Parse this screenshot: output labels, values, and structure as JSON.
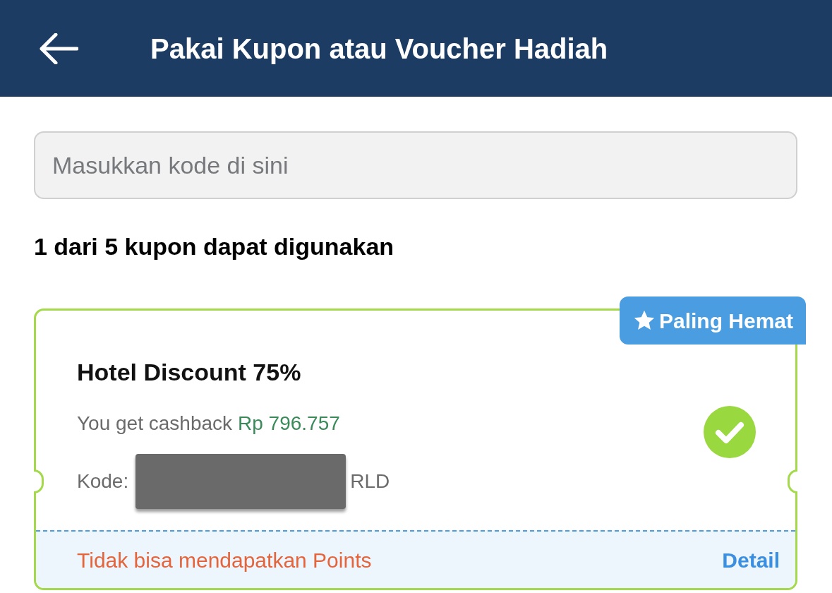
{
  "header": {
    "title": "Pakai Kupon atau Voucher Hadiah"
  },
  "code_field": {
    "placeholder": "Masukkan kode di sini"
  },
  "summary": "1 dari 5 kupon dapat digunakan",
  "coupons": [
    {
      "badge": "Paling Hemat",
      "title": "Hotel Discount 75%",
      "cashback_label": "You get cashback",
      "cashback_amount": "Rp 796.757",
      "code_label": "Kode:",
      "code_visible": "RLD",
      "selected": true,
      "note": "Tidak bisa mendapatkan Points",
      "detail_link": "Detail"
    }
  ]
}
